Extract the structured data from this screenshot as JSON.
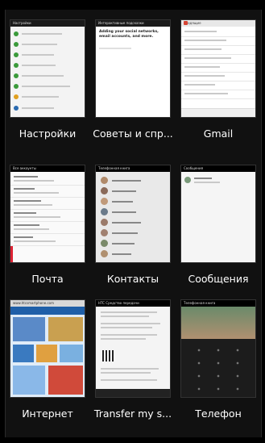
{
  "apps": [
    {
      "label": "Настройки"
    },
    {
      "label": "Советы и спр..."
    },
    {
      "label": "Gmail"
    },
    {
      "label": "Почта"
    },
    {
      "label": "Контакты"
    },
    {
      "label": "Сообщения"
    },
    {
      "label": "Интернет"
    },
    {
      "label": "Transfer my s..."
    },
    {
      "label": "Телефон"
    }
  ],
  "thumbs": {
    "settings_header": "Настройки",
    "tips_header": "Интерактивные подсказки",
    "tips_heading": "Adding your social networks, email accounts, and more.",
    "gmail_header": "Входящие",
    "mail_header": "Все аккаунты",
    "contacts_header": "Телефонная книга",
    "messages_header": "Сообщения",
    "browser_address": "www.htcsmartphone.com",
    "transfer_header": "HTC Средство передачи",
    "phone_header": "Телефонная книга"
  },
  "colors": {
    "background": "#000000",
    "settings_icon_green": "#3a9a3a",
    "gmail_red": "#d64434",
    "contacts_bg": "#e9e9e9",
    "phone_keypad": "#1c1c1c"
  }
}
